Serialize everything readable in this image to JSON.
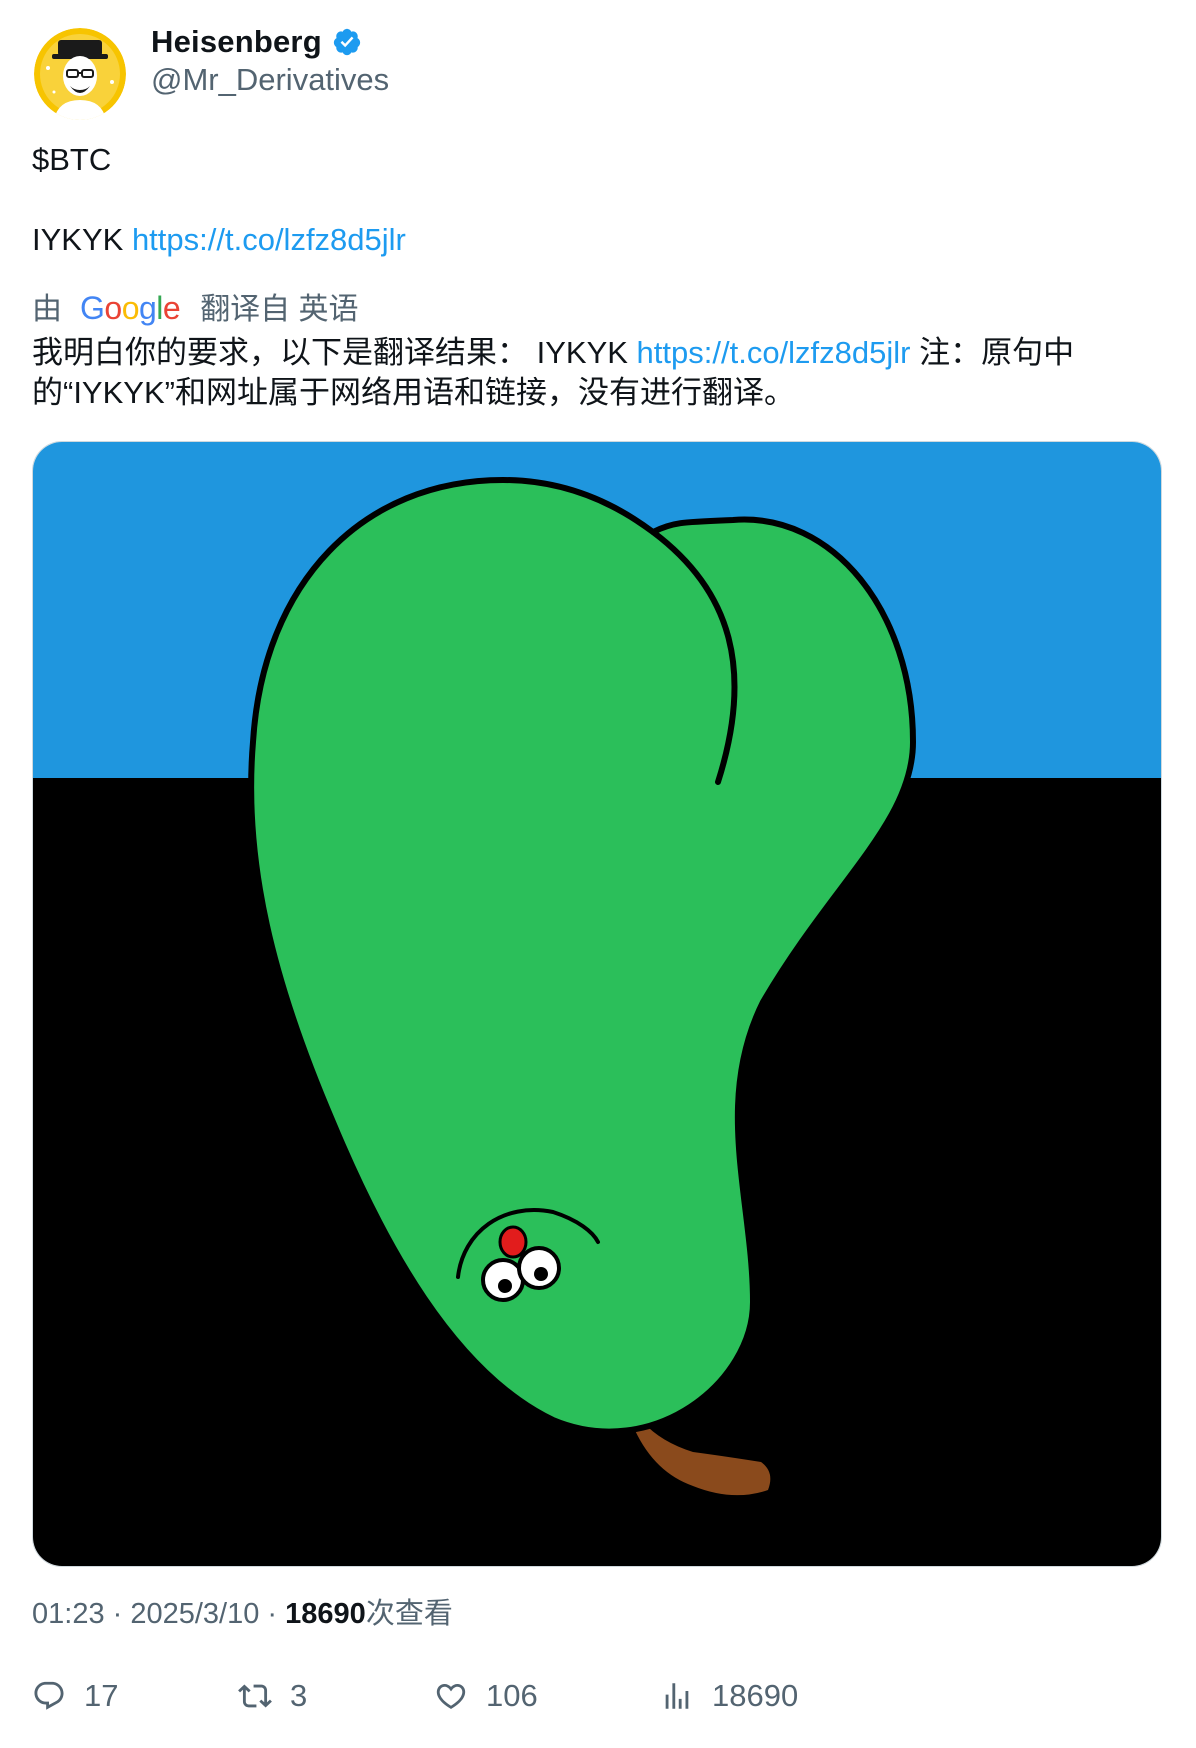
{
  "author": {
    "display_name": "Heisenberg",
    "handle": "@Mr_Derivatives",
    "verified": true,
    "avatar_icon": "heisenberg-avatar"
  },
  "tweet": {
    "line1": "$BTC",
    "line2_text": "IYKYK ",
    "line2_link": "https://t.co/lzfz8d5jlr"
  },
  "translation": {
    "by_label": "由",
    "google_word": "Google",
    "translated_from_label": "翻译自 英语",
    "text_part1": "我明白你的要求，以下是翻译结果： IYKYK ",
    "text_link": "https://t.co/lzfz8d5jlr",
    "text_part2": " 注：原句中的“IYKYK”和网址属于网络用语和链接，没有进行翻译。"
  },
  "media": {
    "description_icon": "green-pear-cartoon-image"
  },
  "meta": {
    "time": "01:23",
    "separator": " · ",
    "date": "2025/3/10",
    "views_count": "18690",
    "views_label": "次查看"
  },
  "actions": {
    "replies": "17",
    "retweets": "3",
    "likes": "106",
    "views": "18690"
  },
  "colors": {
    "link": "#1d9bf0",
    "secondary_text": "#536471",
    "verified_badge": "#1d9bf0",
    "sky": "#1f96de",
    "ground": "#000000",
    "pear_green": "#2bbf5a",
    "stem_brown": "#8a4a1c"
  }
}
